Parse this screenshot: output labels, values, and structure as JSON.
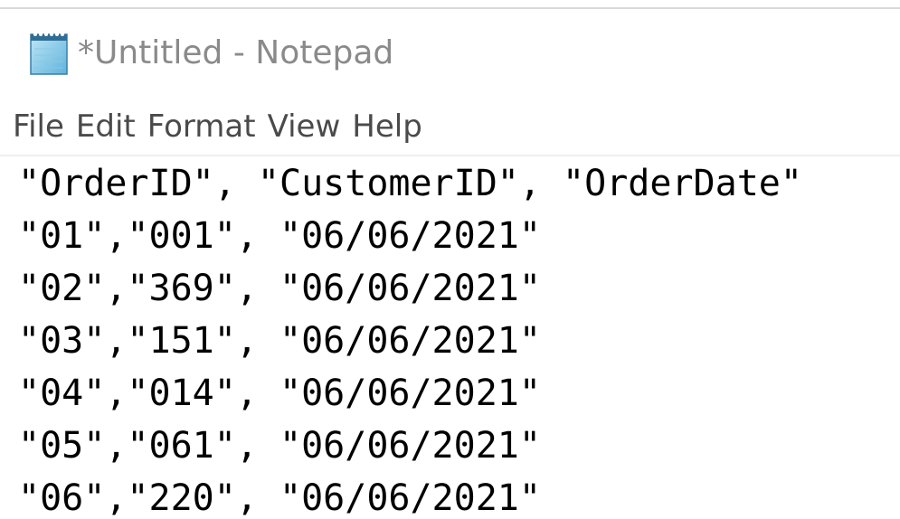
{
  "window": {
    "title": "*Untitled - Notepad",
    "icon": "notepad-icon"
  },
  "menu": {
    "items": [
      "File",
      "Edit",
      "Format",
      "View",
      "Help"
    ]
  },
  "editor": {
    "lines": [
      "\"OrderID\", \"CustomerID\", \"OrderDate\"",
      "\"01\",\"001\", \"06/06/2021\"",
      "\"02\",\"369\", \"06/06/2021\"",
      "\"03\",\"151\", \"06/06/2021\"",
      "\"04\",\"014\", \"06/06/2021\"",
      "\"05\",\"061\", \"06/06/2021\"",
      "\"06\",\"220\", \"06/06/2021\""
    ]
  },
  "colors": {
    "title_text": "#8a8a8a",
    "menu_text": "#4a4a4a",
    "editor_text": "#000000",
    "background": "#ffffff"
  }
}
